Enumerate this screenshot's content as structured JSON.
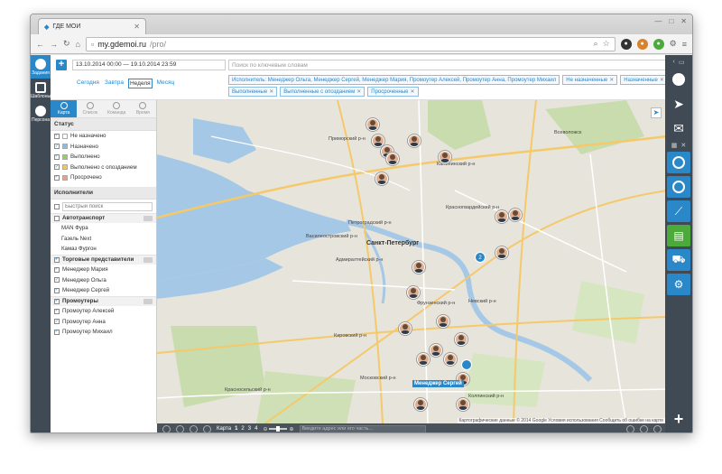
{
  "browser": {
    "tab_title": "ГДЕ МОИ",
    "url_host": "my.gdemoi.ru",
    "url_path": "/pro/"
  },
  "leftbar": {
    "items": [
      {
        "label": "Задания"
      },
      {
        "label": "Шаблоны"
      },
      {
        "label": "Персона"
      }
    ]
  },
  "filters": {
    "date_range": "13.10.2014 00:00 — 19.10.2014 23:59",
    "search_placeholder": "Поиск по ключевым словам",
    "periods": [
      "Сегодня",
      "Завтра",
      "Неделя",
      "Месяц"
    ],
    "active_period": "Неделя",
    "chips": [
      "Исполнитель: Менеджер Ольга, Менеджер Сергей, Менеджер Мария, Промоутер Алексей, Промоутер Анна, Промоутер Михаил",
      "Не назначенные",
      "Назначенные",
      "Выполненные",
      "Выполненные с опозданием",
      "Просроченные"
    ]
  },
  "panel": {
    "tabs": [
      "Карта",
      "Список",
      "Команда",
      "Время"
    ],
    "status_title": "Статус",
    "statuses": [
      {
        "label": "Не назначено",
        "color": "#ffffff"
      },
      {
        "label": "Назначено",
        "color": "#8fbbe0"
      },
      {
        "label": "Выполнено",
        "color": "#9ccc65"
      },
      {
        "label": "Выполнено с опозданием",
        "color": "#f3c563"
      },
      {
        "label": "Просрочено",
        "color": "#e8a08a"
      }
    ],
    "executors_title": "Исполнители",
    "quick_search_placeholder": "Быстрый поиск",
    "groups": [
      {
        "name": "Автотранспорт",
        "members": [
          "MAN Фура",
          "Газель Next",
          "Камаз Фургон"
        ],
        "checked": false
      },
      {
        "name": "Торговые представители",
        "members": [
          "Менеджер Мария",
          "Менеджер Ольга",
          "Менеджер Сергей"
        ],
        "checked": true
      },
      {
        "name": "Промоутеры",
        "members": [
          "Промоутер Алексей",
          "Промоутер Анна",
          "Промоутер Михаил"
        ],
        "checked": true
      }
    ]
  },
  "map": {
    "labels": {
      "primorsky": "Приморский р-н",
      "kalininsky": "Калининский р-н",
      "vsevolozhsk": "Всеволожск",
      "krasnogvardeysky": "Красногвардейский р-н",
      "petrogradsky": "Петроградский р-н",
      "vasileostrovsky": "Василеостровский р-н",
      "spb": "Санкт-Петербург",
      "admiralteysky": "Адмиралтейский р-н",
      "nevsky": "Невский р-н",
      "frunzensky": "Фрунзенский р-н",
      "kirovsky": "Кировский р-н",
      "moskovsky": "Московский р-н",
      "krasnoselsky": "Красносельский р-н",
      "kolpinsky": "Колпинский р-н"
    },
    "cluster_count": "2",
    "callout": "Менеджер Сергей",
    "attribution": "Картографические данные © 2014 Google   Условия использования   Сообщить об ошибке на карте"
  },
  "bottombar": {
    "map_label": "Карта",
    "pages": [
      "1",
      "2",
      "3",
      "4"
    ],
    "search_placeholder": "Введите адрес или его часть..."
  }
}
